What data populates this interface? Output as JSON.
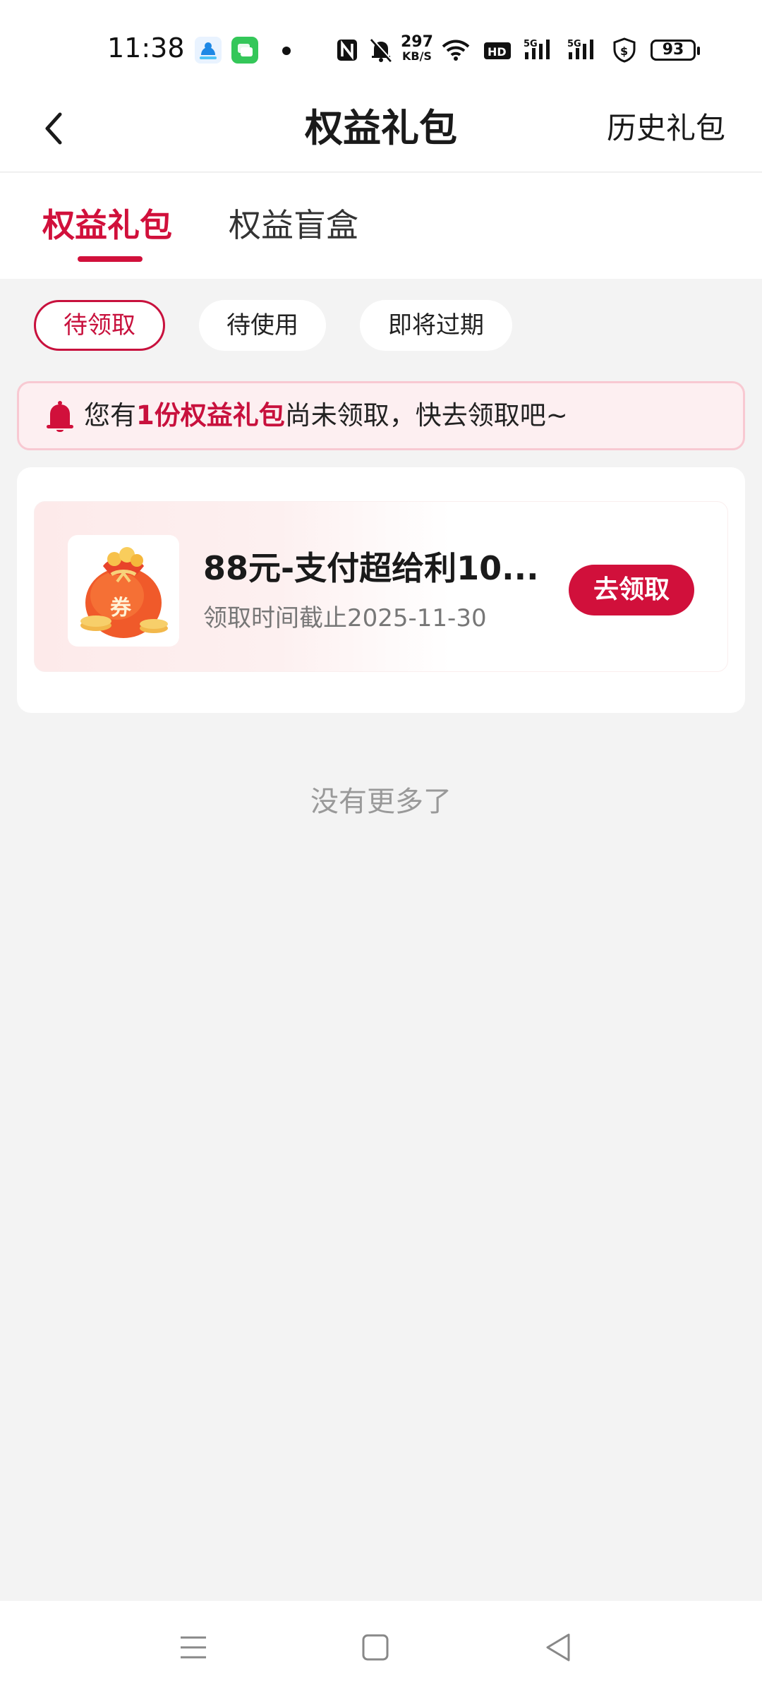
{
  "status_bar": {
    "time": "11:38",
    "speed_value": "297",
    "speed_unit": "KB/S",
    "battery": "93",
    "icons": [
      "app-cloud-icon",
      "app-message-icon",
      "notification-dot",
      "nfc-icon",
      "mute-bell-icon",
      "wifi-icon",
      "hd-icon",
      "signal-5g-icon",
      "signal-5g-icon",
      "shield-dollar-icon",
      "battery-icon"
    ]
  },
  "header": {
    "title": "权益礼包",
    "right_action": "历史礼包"
  },
  "tabs": [
    {
      "label": "权益礼包",
      "active": true
    },
    {
      "label": "权益盲盒",
      "active": false
    }
  ],
  "filters": [
    {
      "label": "待领取",
      "active": true
    },
    {
      "label": "待使用",
      "active": false
    },
    {
      "label": "即将过期",
      "active": false
    }
  ],
  "notice": {
    "prefix": "您有",
    "highlight": "1份权益礼包",
    "suffix": "尚未领取，快去领取吧~"
  },
  "items": [
    {
      "image_label": "券",
      "title": "88元-支付超给利10...",
      "subtitle": "领取时间截止2025-11-30",
      "button": "去领取"
    }
  ],
  "footer_text": "没有更多了",
  "colors": {
    "accent": "#d1103b",
    "background": "#f3f3f3",
    "notice_bg": "#fdeff1"
  }
}
